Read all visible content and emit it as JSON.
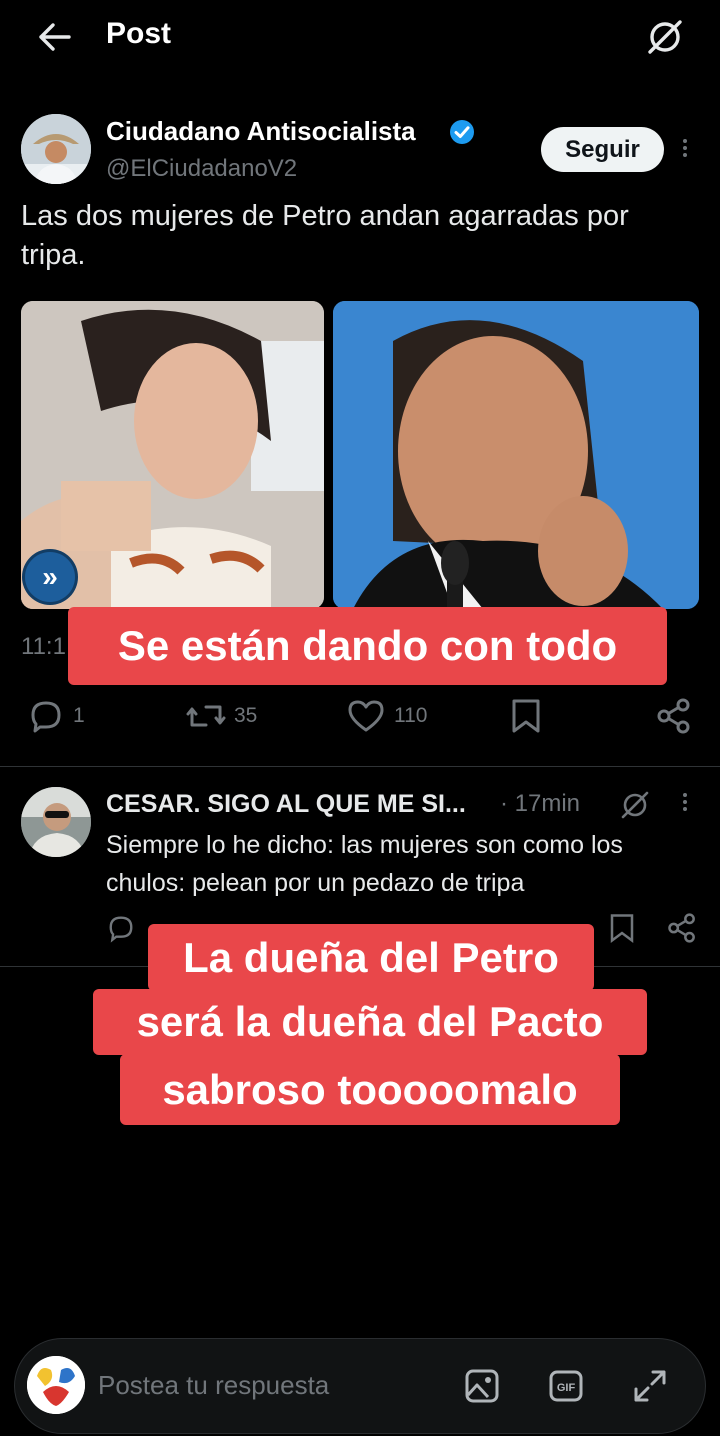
{
  "header": {
    "title": "Post"
  },
  "post": {
    "author_name": "Ciudadano Antisocialista",
    "author_handle": "@ElCiudadanoV2",
    "follow_label": "Seguir",
    "text": "Las dos mujeres de Petro andan agarradas por tripa.",
    "time_partial": "11:1",
    "stats": {
      "replies": "1",
      "reposts": "35",
      "likes": "110"
    },
    "media_pill_glyph": "»"
  },
  "reply": {
    "author_name": "CESAR. SIGO AL QUE ME SI...",
    "time": "· 17min",
    "text": "Siempre lo he dicho: las mujeres son como los chulos: pelean por un pedazo de tripa"
  },
  "overlay": {
    "caption_top": "Se están dando con todo",
    "caption_lines": [
      "La dueña del Petro",
      "será la dueña del Pacto",
      "sabroso tooooomalo"
    ]
  },
  "composer": {
    "placeholder": "Postea tu respuesta"
  },
  "colors": {
    "background": "#000000",
    "caption_bg": "#e9474a",
    "verified": "#1d9bf0",
    "muted": "#71767b"
  },
  "icons": [
    "back-arrow-icon",
    "grok-icon",
    "verified-badge-icon",
    "more-vertical-icon",
    "reply-icon",
    "repost-icon",
    "like-icon",
    "bookmark-icon",
    "share-icon",
    "image-icon",
    "gif-icon",
    "expand-icon"
  ]
}
